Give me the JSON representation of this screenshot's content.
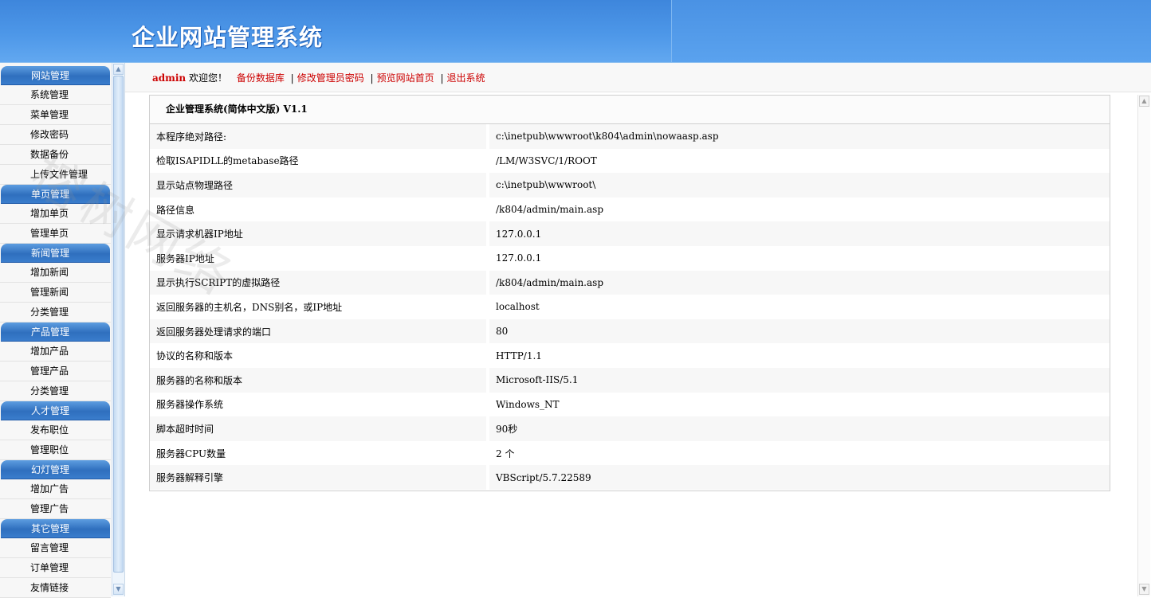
{
  "header": {
    "title": "企业网站管理系统"
  },
  "sidebar": {
    "groups": [
      {
        "title": "网站管理",
        "items": [
          "系统管理",
          "菜单管理",
          "修改密码",
          "数据备份",
          "上传文件管理"
        ]
      },
      {
        "title": "单页管理",
        "items": [
          "增加单页",
          "管理单页"
        ]
      },
      {
        "title": "新闻管理",
        "items": [
          "增加新闻",
          "管理新闻",
          "分类管理"
        ]
      },
      {
        "title": "产品管理",
        "items": [
          "增加产品",
          "管理产品",
          "分类管理"
        ]
      },
      {
        "title": "人才管理",
        "items": [
          "发布职位",
          "管理职位"
        ]
      },
      {
        "title": "幻灯管理",
        "items": [
          "增加广告",
          "管理广告"
        ]
      },
      {
        "title": "其它管理",
        "items": [
          "留言管理",
          "订单管理",
          "友情链接"
        ]
      }
    ]
  },
  "topbar": {
    "user": "admin",
    "welcome": " 欢迎您！",
    "links": [
      "备份数据库",
      "修改管理员密码",
      "预览网站首页",
      "退出系统"
    ],
    "separator": "|"
  },
  "info": {
    "title": "企业管理系统(简体中文版) V1.1",
    "rows": [
      {
        "label": "本程序绝对路径:",
        "value": "c:\\inetpub\\wwwroot\\k804\\admin\\nowaasp.asp"
      },
      {
        "label": "检取ISAPIDLL的metabase路径",
        "value": "/LM/W3SVC/1/ROOT"
      },
      {
        "label": "显示站点物理路径",
        "value": "c:\\inetpub\\wwwroot\\"
      },
      {
        "label": "路径信息",
        "value": "/k804/admin/main.asp"
      },
      {
        "label": "显示请求机器IP地址",
        "value": "127.0.0.1"
      },
      {
        "label": "服务器IP地址",
        "value": "127.0.0.1"
      },
      {
        "label": "显示执行SCRIPT的虚拟路径",
        "value": "/k804/admin/main.asp"
      },
      {
        "label": "返回服务器的主机名，DNS别名，或IP地址",
        "value": "localhost"
      },
      {
        "label": "返回服务器处理请求的端口",
        "value": "80"
      },
      {
        "label": "协议的名称和版本",
        "value": "HTTP/1.1"
      },
      {
        "label": "服务器的名称和版本",
        "value": "Microsoft-IIS/5.1"
      },
      {
        "label": "服务器操作系统",
        "value": "Windows_NT"
      },
      {
        "label": "脚本超时时间",
        "value": "90秒"
      },
      {
        "label": "服务器CPU数量",
        "value": "2 个"
      },
      {
        "label": "服务器解释引擎",
        "value": "VBScript/5.7.22589"
      }
    ]
  },
  "watermark": {
    "text": "榕树网络"
  },
  "colors": {
    "header_blue": "#4d97e8",
    "link_red": "#cc0000",
    "menu_header_blue": "#2f6fbe"
  }
}
